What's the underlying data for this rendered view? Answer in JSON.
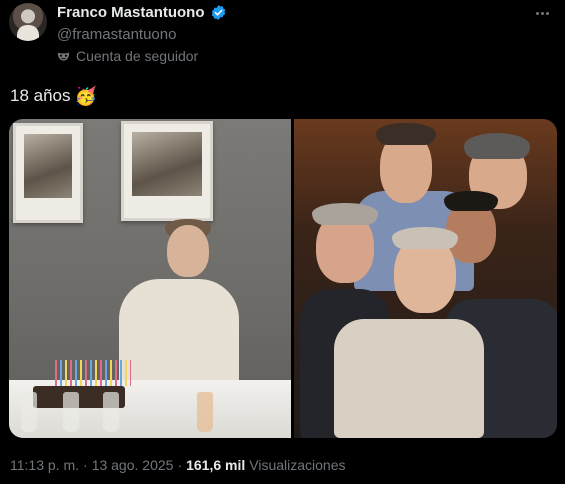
{
  "author": {
    "display_name": "Franco Mastantuono",
    "handle": "@framastantuono",
    "verified_icon": "verified-badge-icon",
    "verified_color": "#1d9bf0",
    "follower_label": "Cuenta de seguidor",
    "follower_icon": "mask-icon"
  },
  "tweet": {
    "text": "18 años",
    "emoji": "🥳"
  },
  "media": {
    "photos": [
      {
        "name": "photo-birthday-cake"
      },
      {
        "name": "photo-group-selfie"
      }
    ]
  },
  "meta": {
    "time": "11:13 p. m.",
    "separator": "·",
    "date": "13 ago. 2025",
    "separator2": "·",
    "views_count": "161,6 mil",
    "views_label": "Visualizaciones"
  },
  "colors": {
    "background": "#000000",
    "text_primary": "#e7e9ea",
    "text_secondary": "#71767b"
  }
}
